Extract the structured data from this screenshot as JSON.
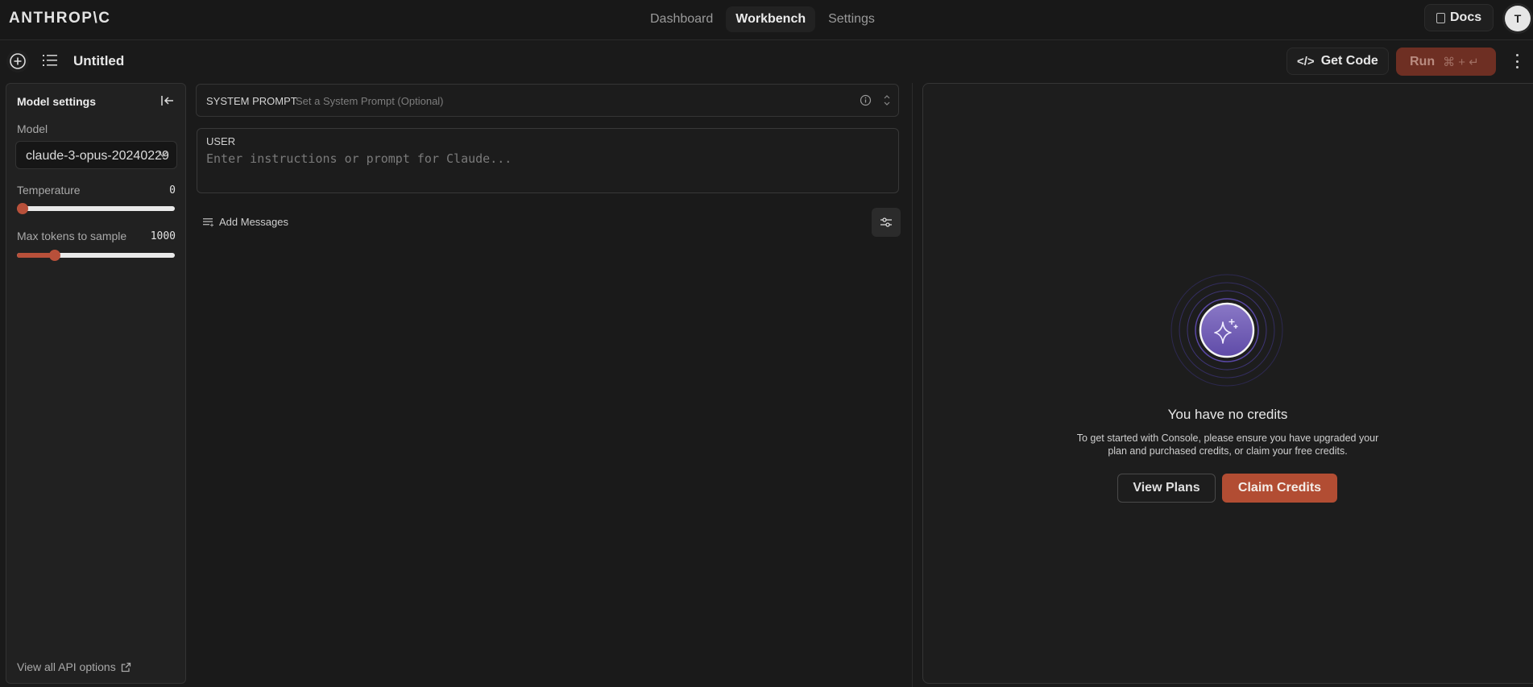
{
  "topbar": {
    "logo": "ANTHROP\\C",
    "nav": [
      {
        "label": "Dashboard",
        "active": false
      },
      {
        "label": "Workbench",
        "active": true
      },
      {
        "label": "Settings",
        "active": false
      }
    ],
    "docs_label": "Docs",
    "avatar_initial": "T"
  },
  "toolbar": {
    "title": "Untitled",
    "get_code_label": "Get Code",
    "run_label": "Run",
    "run_shortcut": "⌘ + ↵"
  },
  "model_settings": {
    "title": "Model settings",
    "model_label": "Model",
    "model_value": "claude-3-opus-20240229",
    "temperature_label": "Temperature",
    "temperature_value": "0",
    "temperature_fraction": 0.0,
    "max_tokens_label": "Max tokens to sample",
    "max_tokens_value": "1000",
    "max_tokens_fraction": 0.24,
    "api_link": "View all API options"
  },
  "prompt": {
    "system_label": "SYSTEM PROMPT",
    "system_placeholder": "Set a System Prompt (Optional)",
    "user_label": "USER",
    "user_placeholder": "Enter instructions or prompt for Claude...",
    "add_messages_label": "Add Messages"
  },
  "output": {
    "title": "You have no credits",
    "description": "To get started with Console, please ensure you have upgraded your plan and purchased credits, or claim your free credits.",
    "view_plans_label": "View Plans",
    "claim_credits_label": "Claim Credits"
  },
  "colors": {
    "accent": "#b24d33",
    "run_disabled": "#6e2f23",
    "credits_purple": "#6e5bb8"
  }
}
